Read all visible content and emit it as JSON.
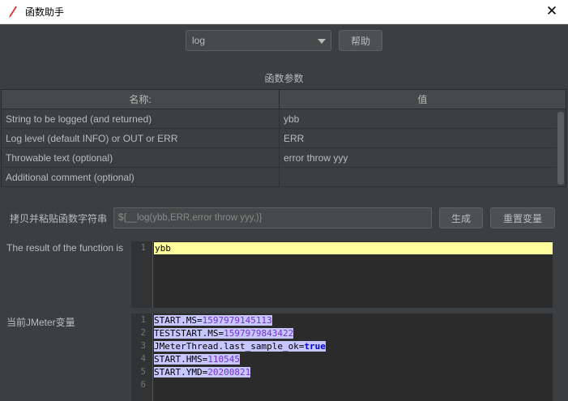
{
  "window": {
    "title": "函数助手",
    "close_glyph": "✕"
  },
  "function_select": {
    "value": "log"
  },
  "help_button": {
    "label": "帮助"
  },
  "params_section": {
    "title": "函数参数",
    "columns": {
      "name": "名称:",
      "value": "值"
    },
    "rows": [
      {
        "name": "String to be logged (and returned)",
        "value": "ybb"
      },
      {
        "name": "Log level (default INFO) or OUT or ERR",
        "value": "ERR"
      },
      {
        "name": "Throwable text (optional)",
        "value": "error throw yyy"
      },
      {
        "name": "Additional comment (optional)",
        "value": ""
      }
    ]
  },
  "copy_paste": {
    "label": "拷贝并粘贴函数字符串",
    "value": "${__log(ybb,ERR,error throw yyy,)}",
    "generate_button": "生成",
    "reset_button": "重置变量"
  },
  "result": {
    "label": "The result of the function is",
    "lines": [
      {
        "num": "1",
        "text": "ybb"
      }
    ]
  },
  "vars": {
    "label": "当前JMeter变量",
    "lines": [
      {
        "num": "1",
        "key": "START.MS",
        "eq": "=",
        "val": "1597979145113"
      },
      {
        "num": "2",
        "key": "TESTSTART.MS",
        "eq": "=",
        "val": "1597979843422"
      },
      {
        "num": "3",
        "key": "JMeterThread.last_sample_ok",
        "eq": "=",
        "val": "true"
      },
      {
        "num": "4",
        "key": "START.HMS",
        "eq": "=",
        "val": "110545"
      },
      {
        "num": "5",
        "key": "START.YMD",
        "eq": "=",
        "val": "20200821"
      },
      {
        "num": "6",
        "key": "",
        "eq": "",
        "val": ""
      }
    ]
  },
  "colors": {
    "background": "#3c3f41",
    "editor_bg": "#2b2b2b",
    "result_highlight": "#ffff9e",
    "selection": "#c7c7ff",
    "number": "#7a2fd6",
    "keyword": "#0000c8"
  },
  "icons": {
    "app": "feather-pen-icon",
    "close": "close-icon",
    "dropdown": "chevron-down-icon"
  }
}
